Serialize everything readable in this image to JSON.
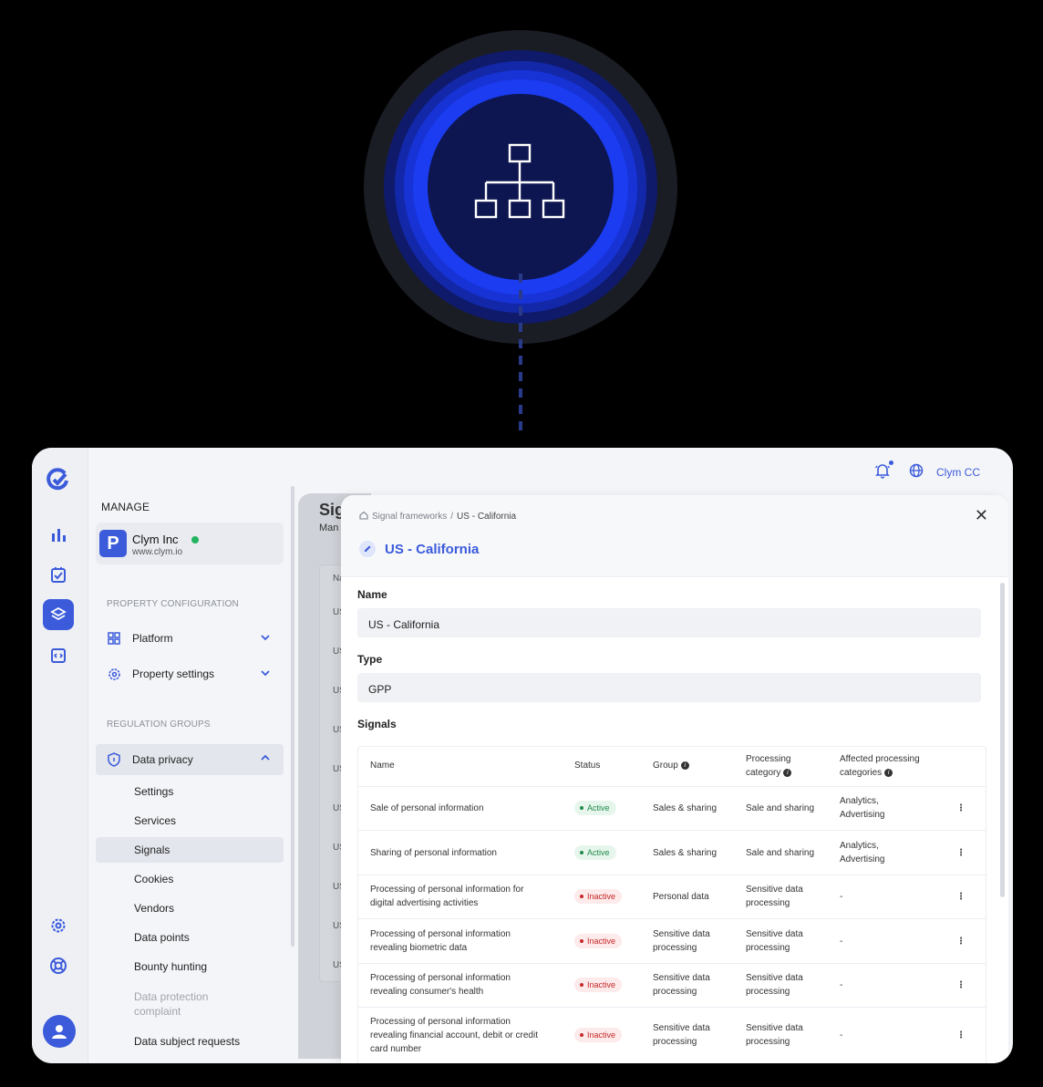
{
  "hero": {
    "icon": "sitemap-icon"
  },
  "rail": {
    "items": [
      "logo-icon",
      "analytics-icon",
      "tasks-icon",
      "layers-icon",
      "code-icon",
      "settings-icon",
      "support-icon",
      "user-icon"
    ],
    "accent": "#3b5bdb"
  },
  "sidebar": {
    "manage_label": "MANAGE",
    "org": {
      "initial": "P",
      "name": "Clym Inc",
      "url": "www.clym.io"
    },
    "property_config_label": "PROPERTY CONFIGURATION",
    "platform_label": "Platform",
    "property_settings_label": "Property settings",
    "regulation_groups_label": "REGULATION GROUPS",
    "data_privacy_label": "Data privacy",
    "sub_items": [
      "Settings",
      "Services",
      "Signals",
      "Cookies",
      "Vendors",
      "Data points",
      "Bounty hunting"
    ],
    "data_protection_complaint": [
      "Data protection",
      "complaint"
    ],
    "data_subject_requests": "Data subject requests"
  },
  "topbar": {
    "user_label": "Clym CC"
  },
  "background_page": {
    "title": "Sig",
    "subtitle": "Man",
    "col_header": "Na",
    "cell_prefix": "US"
  },
  "panel": {
    "breadcrumb": {
      "parent": "Signal frameworks",
      "separator": "/",
      "current": "US - California"
    },
    "close": "✕",
    "title": "US - California",
    "name_label": "Name",
    "name_value": "US - California",
    "type_label": "Type",
    "type_value": "GPP",
    "signals_label": "Signals",
    "table": {
      "headers": {
        "name": "Name",
        "status": "Status",
        "group": "Group",
        "processing_category": [
          "Processing",
          "category"
        ],
        "affected": [
          "Affected processing",
          "categories"
        ]
      },
      "rows": [
        {
          "name": [
            "Sale of personal information"
          ],
          "status": "Active",
          "group": [
            "Sales & sharing"
          ],
          "category": [
            "Sale and sharing"
          ],
          "affected": [
            "Analytics,",
            "Advertising"
          ]
        },
        {
          "name": [
            "Sharing of personal information"
          ],
          "status": "Active",
          "group": [
            "Sales & sharing"
          ],
          "category": [
            "Sale and sharing"
          ],
          "affected": [
            "Analytics,",
            "Advertising"
          ]
        },
        {
          "name": [
            "Processing of personal information for",
            "digital advertising activities"
          ],
          "status": "Inactive",
          "group": [
            "Personal data"
          ],
          "category": [
            "Sensitive data",
            "processing"
          ],
          "affected": [
            "-"
          ]
        },
        {
          "name": [
            "Processing of personal information",
            "revealing biometric data"
          ],
          "status": "Inactive",
          "group": [
            "Sensitive data",
            "processing"
          ],
          "category": [
            "Sensitive data",
            "processing"
          ],
          "affected": [
            "-"
          ]
        },
        {
          "name": [
            "Processing of personal information",
            "revealing consumer's health"
          ],
          "status": "Inactive",
          "group": [
            "Sensitive data",
            "processing"
          ],
          "category": [
            "Sensitive data",
            "processing"
          ],
          "affected": [
            "-"
          ]
        },
        {
          "name": [
            "Processing of personal information",
            "revealing financial account, debit or credit",
            "card number"
          ],
          "status": "Inactive",
          "group": [
            "Sensitive data",
            "processing"
          ],
          "category": [
            "Sensitive data",
            "processing"
          ],
          "affected": [
            "-"
          ]
        }
      ]
    }
  }
}
